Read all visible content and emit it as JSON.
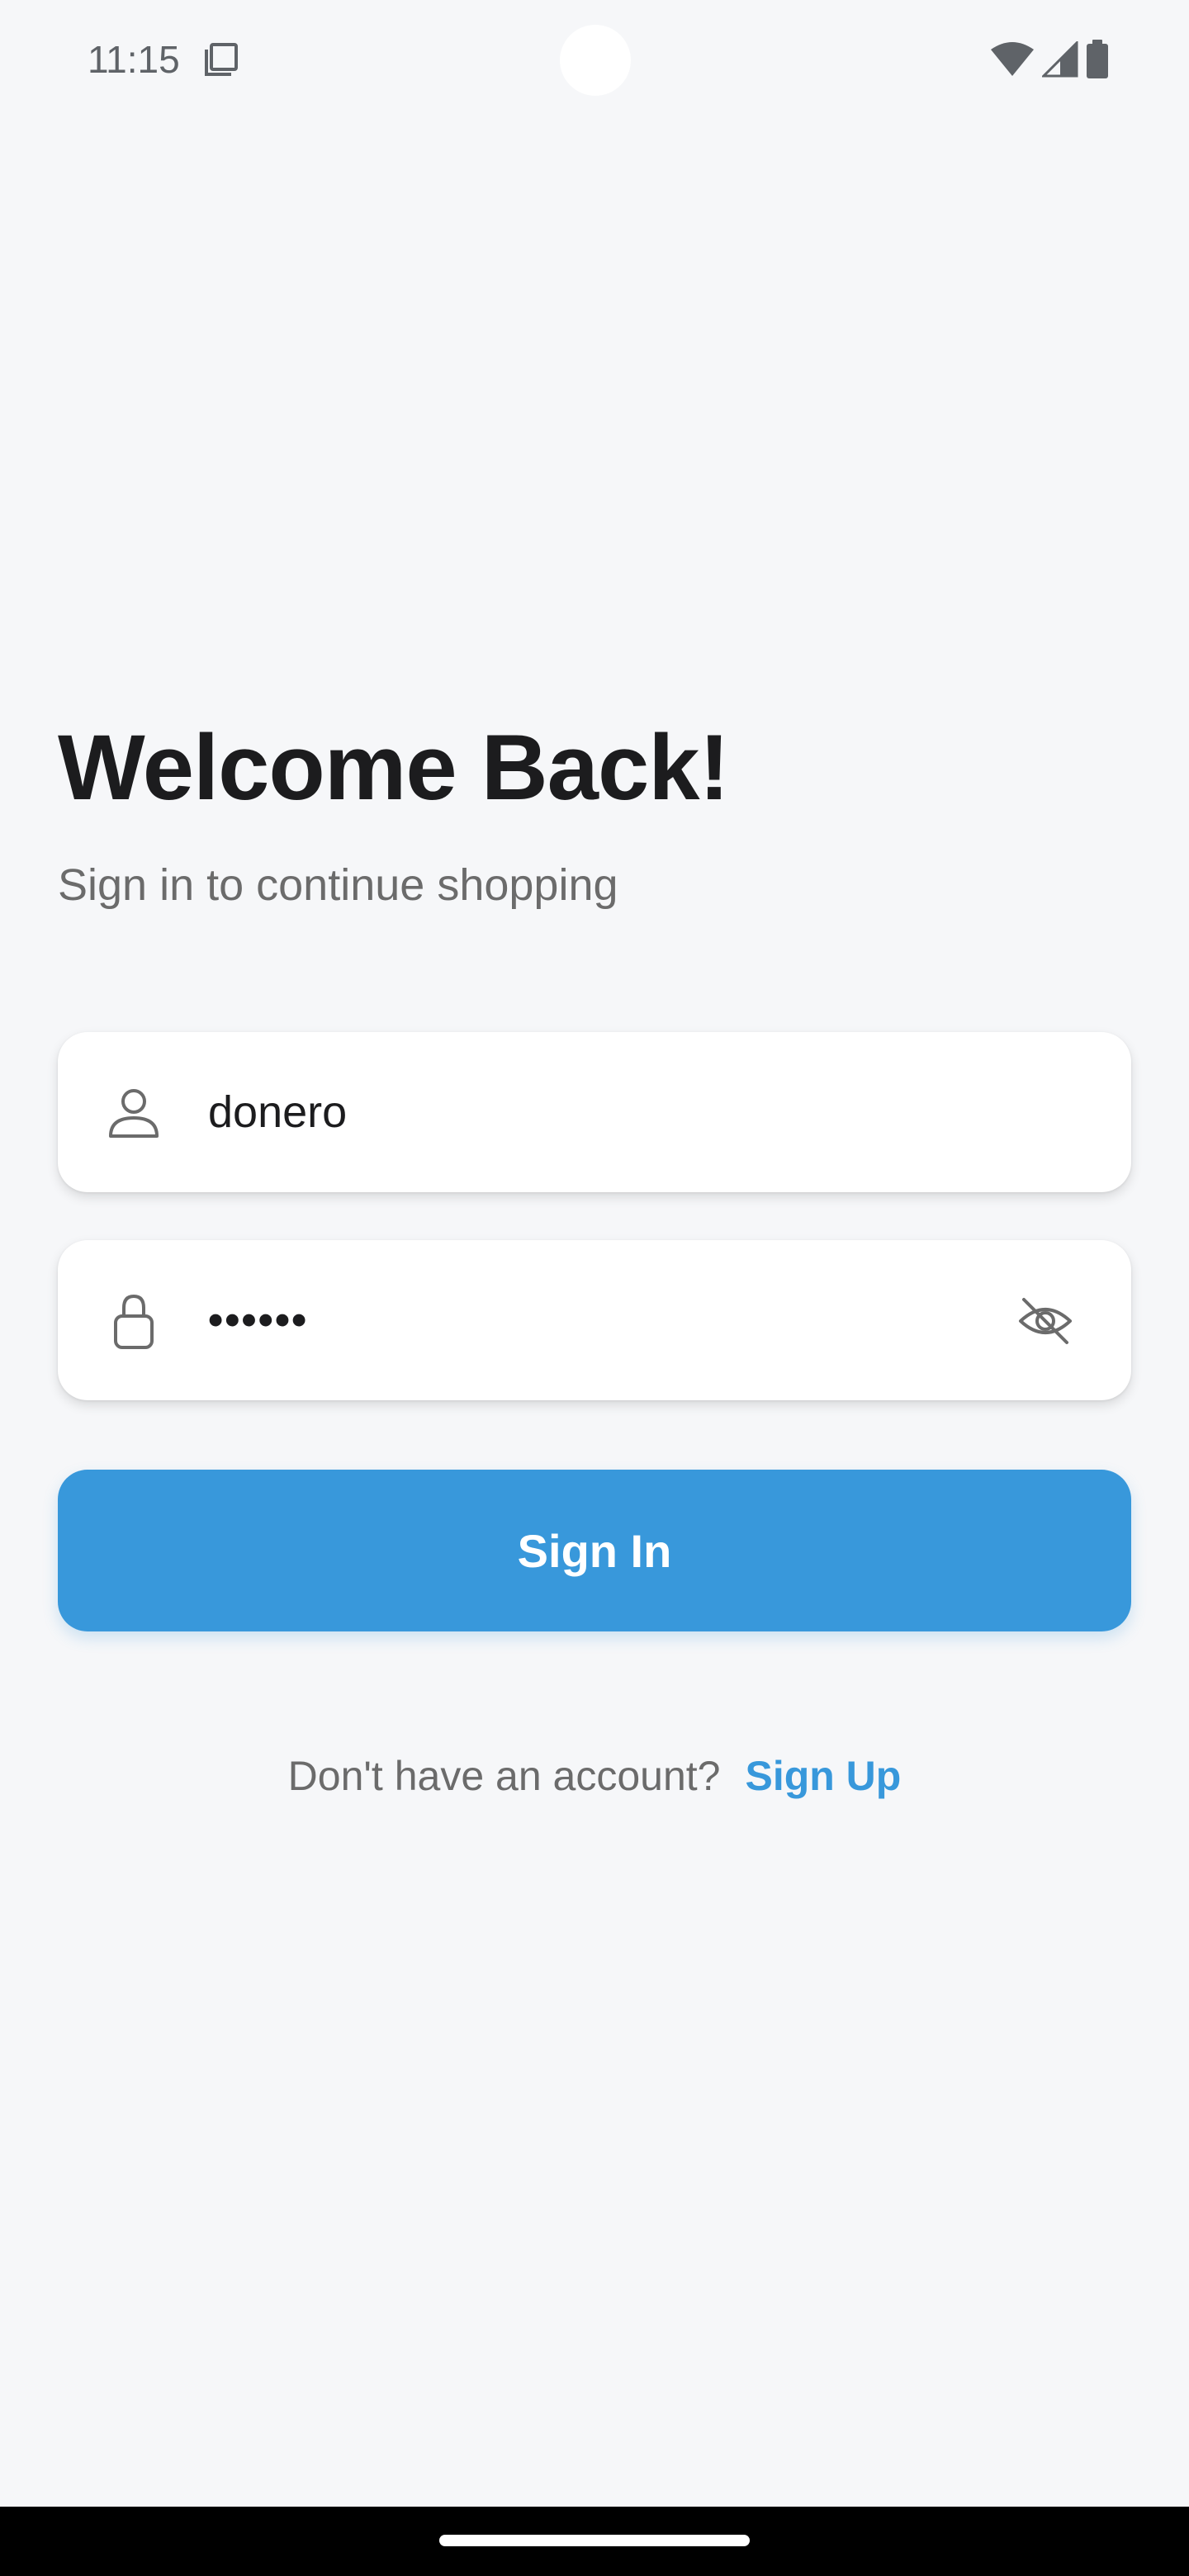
{
  "status_bar": {
    "time": "11:15",
    "icons": [
      "sim-card-icon",
      "wifi-icon",
      "cellular-signal-icon",
      "battery-icon"
    ]
  },
  "login": {
    "title": "Welcome Back!",
    "subtitle": "Sign in to continue shopping",
    "username": {
      "icon": "user-icon",
      "value": "donero"
    },
    "password": {
      "icon": "lock-icon",
      "value": "••••••",
      "toggle_icon": "eye-off-icon"
    },
    "signin_label": "Sign In",
    "signup_prompt": "Don't have an account?",
    "signup_link": "Sign Up"
  },
  "colors": {
    "background": "#f6f7f9",
    "accent": "#3898db",
    "title_text": "#1c1c1e",
    "secondary_text": "#6b6b6b"
  }
}
